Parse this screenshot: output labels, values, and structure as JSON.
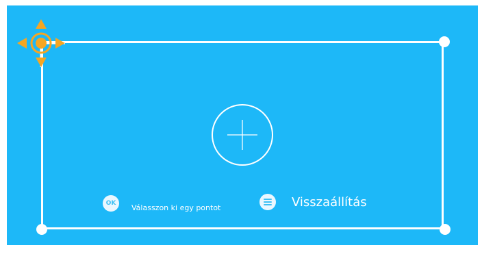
{
  "screen": {
    "background_color": "#1db8f8",
    "frame_color": "#ffffff",
    "accent_color": "#f5a623"
  },
  "handle": {
    "icon": "move-arrows-icon"
  },
  "crosshair": {
    "icon": "crosshair-icon"
  },
  "hint": {
    "badge_text": "OK",
    "label": "Válasszon ki egy pontot"
  },
  "reset": {
    "icon": "menu-icon",
    "label": "Visszaállítás"
  }
}
